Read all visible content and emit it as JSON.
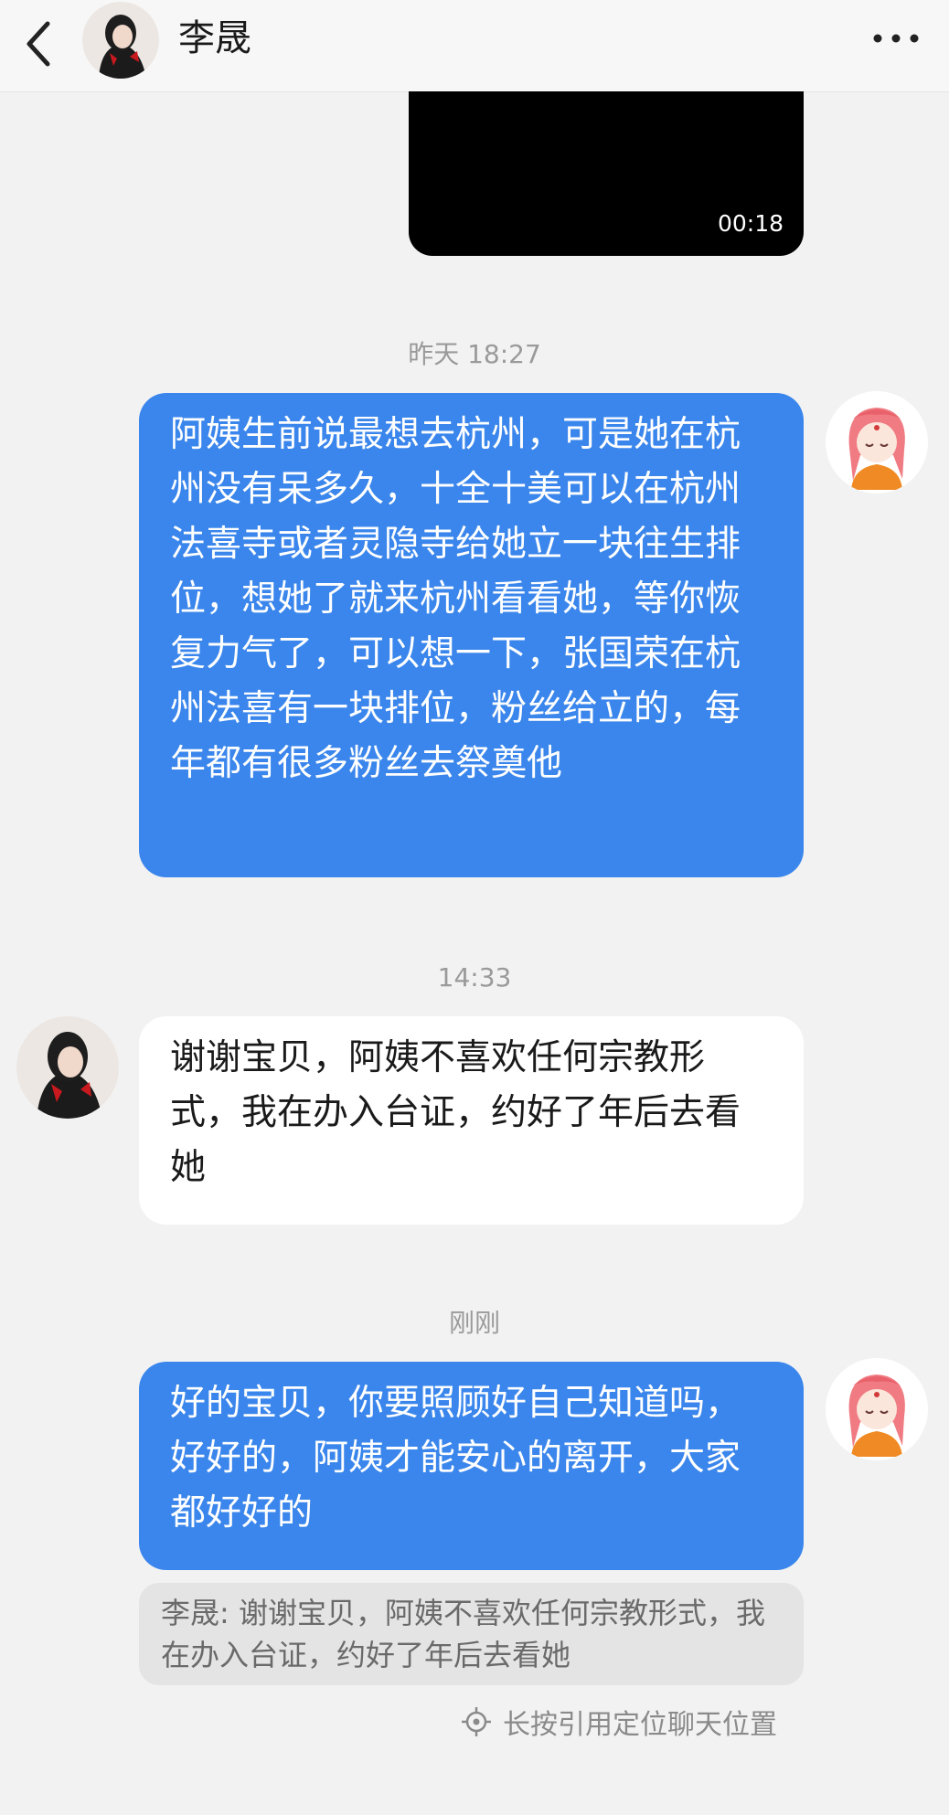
{
  "header": {
    "title": "李晟",
    "back_icon": "chevron-left-icon",
    "more_icon": "more-dots-icon"
  },
  "video": {
    "duration": "00:18"
  },
  "messages": [
    {
      "timestamp": "昨天 18:27",
      "direction": "out",
      "text": "阿姨生前说最想去杭州，可是她在杭州没有呆多久，十全十美可以在杭州法喜寺或者灵隐寺给她立一块往生排位，想她了就来杭州看看她，等你恢复力气了，可以想一下，张国荣在杭州法喜有一块排位，粉丝给立的，每年都有很多粉丝去祭奠他"
    },
    {
      "timestamp": "14:33",
      "direction": "in",
      "text": "谢谢宝贝，阿姨不喜欢任何宗教形式，我在办入台证，约好了年后去看她"
    },
    {
      "timestamp": "刚刚",
      "direction": "out",
      "text": "好的宝贝，你要照顾好自己知道吗，好好的，阿姨才能安心的离开，大家都好好的"
    }
  ],
  "quote": {
    "text": "李晟: 谢谢宝贝，阿姨不喜欢任何宗教形式，我在办入台证，约好了年后去看她"
  },
  "locate_hint": {
    "label": "长按引用定位聊天位置",
    "icon": "locate-icon"
  },
  "colors": {
    "outgoing_bubble": "#3a86ec",
    "incoming_bubble": "#ffffff",
    "background": "#f2f2f2"
  }
}
